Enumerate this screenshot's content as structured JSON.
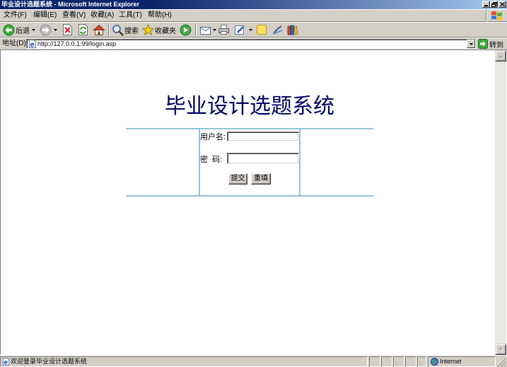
{
  "window": {
    "title": "毕业设计选题系统 - Microsoft Internet Explorer"
  },
  "menu": {
    "items": [
      {
        "label": "文件(F)"
      },
      {
        "label": "编辑(E)"
      },
      {
        "label": "查看(V)"
      },
      {
        "label": "收藏(A)"
      },
      {
        "label": "工具(T)"
      },
      {
        "label": "帮助(H)"
      }
    ]
  },
  "toolbar": {
    "back_label": "后退",
    "search_label": "搜索",
    "favorites_label": "收藏夹",
    "icons": [
      "back-icon",
      "forward-icon",
      "stop-icon",
      "refresh-icon",
      "home-icon",
      "search-icon",
      "favorites-icon",
      "media-icon",
      "mail-icon",
      "print-icon",
      "edit-icon",
      "discuss-icon",
      "messenger-icon",
      "research-icon"
    ]
  },
  "address": {
    "label": "地址(D)",
    "url": "http://127.0.0.1:99/login.asp",
    "go_label": "转到"
  },
  "page": {
    "heading": "毕业设计选题系统",
    "form": {
      "username_label": "用户名:",
      "username_value": "",
      "password_label": "密  码:",
      "password_value": "",
      "submit_label": "提交",
      "reset_label": "重填"
    }
  },
  "status": {
    "text": "欢迎登录毕业设计选题系统",
    "zone_label": "Internet"
  },
  "colors": {
    "title_bar_start": "#0a246a",
    "title_bar_end": "#a6caf0",
    "chrome": "#d4d0c8",
    "heading": "#000066",
    "form_rule": "#8cc4dc"
  }
}
